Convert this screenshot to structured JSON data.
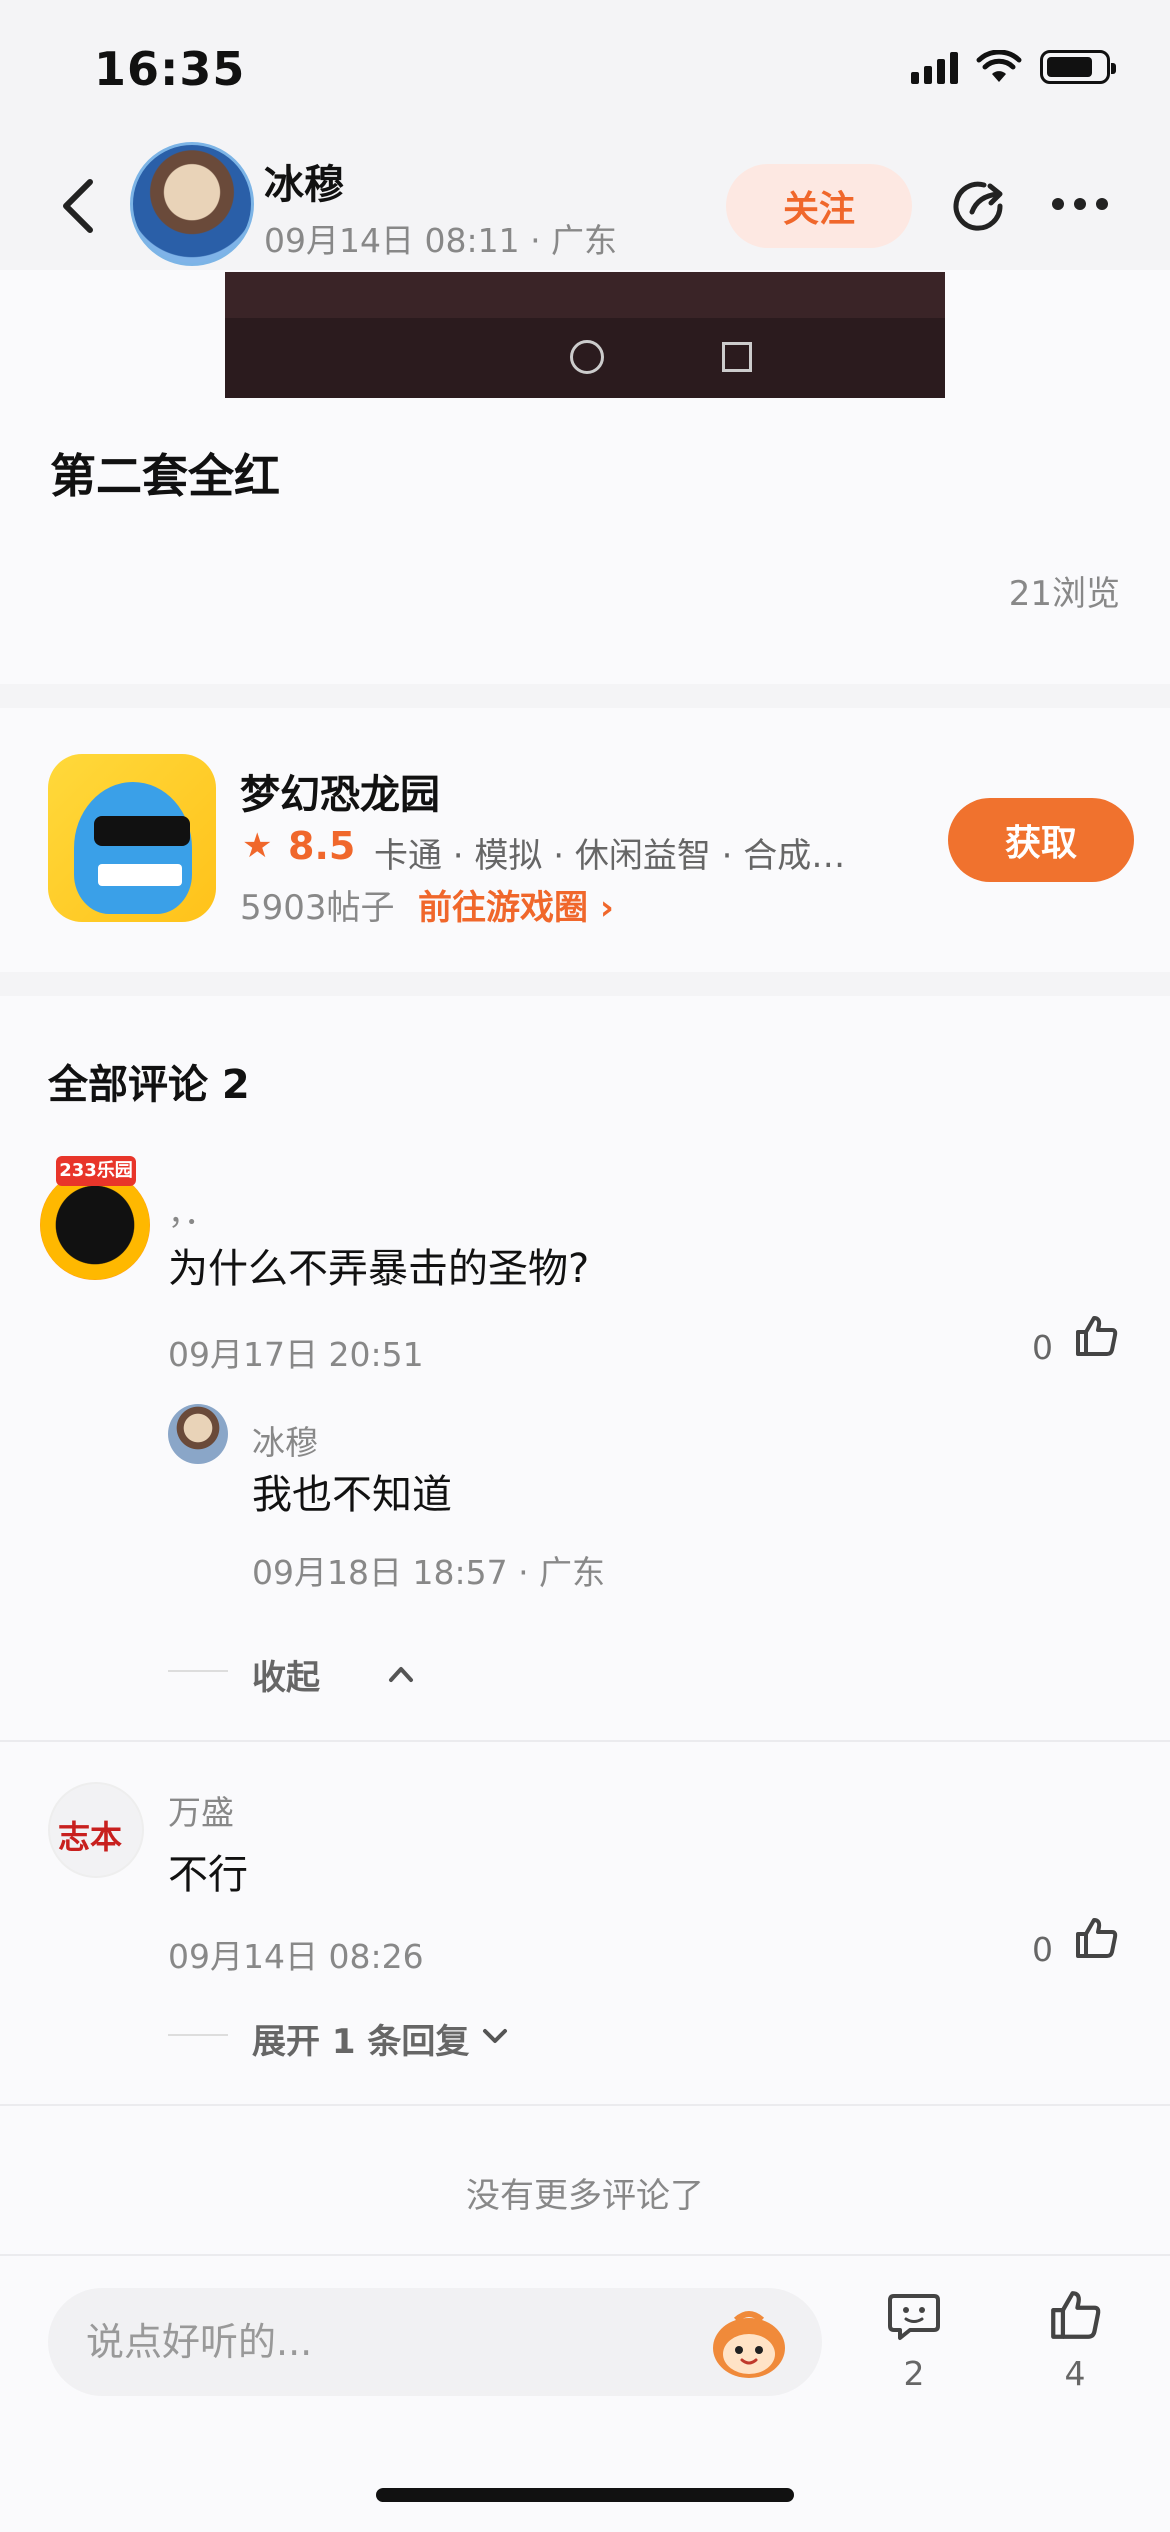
{
  "status_bar": {
    "time": "16:35"
  },
  "header": {
    "author_name": "冰穆",
    "post_meta": "09月14日 08:11 · 广东",
    "follow_label": "关注"
  },
  "post": {
    "title": "第二套全红",
    "views": "21浏览"
  },
  "game_card": {
    "name": "梦幻恐龙园",
    "score": "8.5",
    "tags": "卡通 · 模拟 · 休闲益智 · 合成…",
    "posts": "5903帖子",
    "link_label": "前往游戏圈 ›",
    "get_label": "获取"
  },
  "comments": {
    "header": "全部评论 2",
    "items": [
      {
        "name": "，．",
        "text": "为什么不弄暴击的圣物?",
        "time": "09月17日 20:51",
        "likes": "0",
        "avatar_tag": "233乐园",
        "replies": [
          {
            "name": "冰穆",
            "text": "我也不知道",
            "meta": "09月18日 18:57 · 广东"
          }
        ],
        "toggle_label": "收起"
      },
      {
        "name": "万盛",
        "text": "不行",
        "time": "09月14日 08:26",
        "likes": "0",
        "avatar_text": "志本",
        "toggle_label": "展开 1 条回复"
      }
    ],
    "no_more": "没有更多评论了"
  },
  "bottom_bar": {
    "input_placeholder": "说点好听的...",
    "comment_count": "2",
    "like_count": "4"
  },
  "colors": {
    "accent": "#f0672b",
    "follow_bg": "#fde8e2",
    "get_button": "#f0722e",
    "page_bg": "#f4f4f6"
  }
}
